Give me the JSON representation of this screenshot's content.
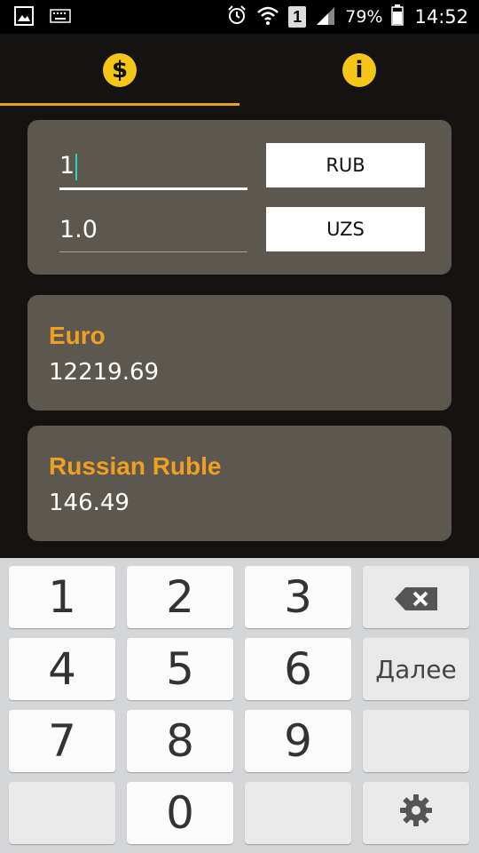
{
  "status_bar": {
    "battery": "79%",
    "sim_slot": "1",
    "time": "14:52"
  },
  "tabs": [
    {
      "icon": "$",
      "name": "converter"
    },
    {
      "icon": "i",
      "name": "info"
    }
  ],
  "converter": {
    "amount_value": "1",
    "result_value": "1.0",
    "from_currency": "RUB",
    "to_currency": "UZS"
  },
  "results": [
    {
      "name": "Euro",
      "value": "12219.69"
    },
    {
      "name": "Russian Ruble",
      "value": "146.49"
    }
  ],
  "keyboard": {
    "keys": [
      "1",
      "2",
      "3",
      "4",
      "5",
      "6",
      "7",
      "8",
      "9",
      "0"
    ],
    "next_label": "Далее"
  },
  "colors": {
    "accent": "#e8a21a",
    "card_bg": "#5c5850",
    "title_color": "#f0a020"
  }
}
